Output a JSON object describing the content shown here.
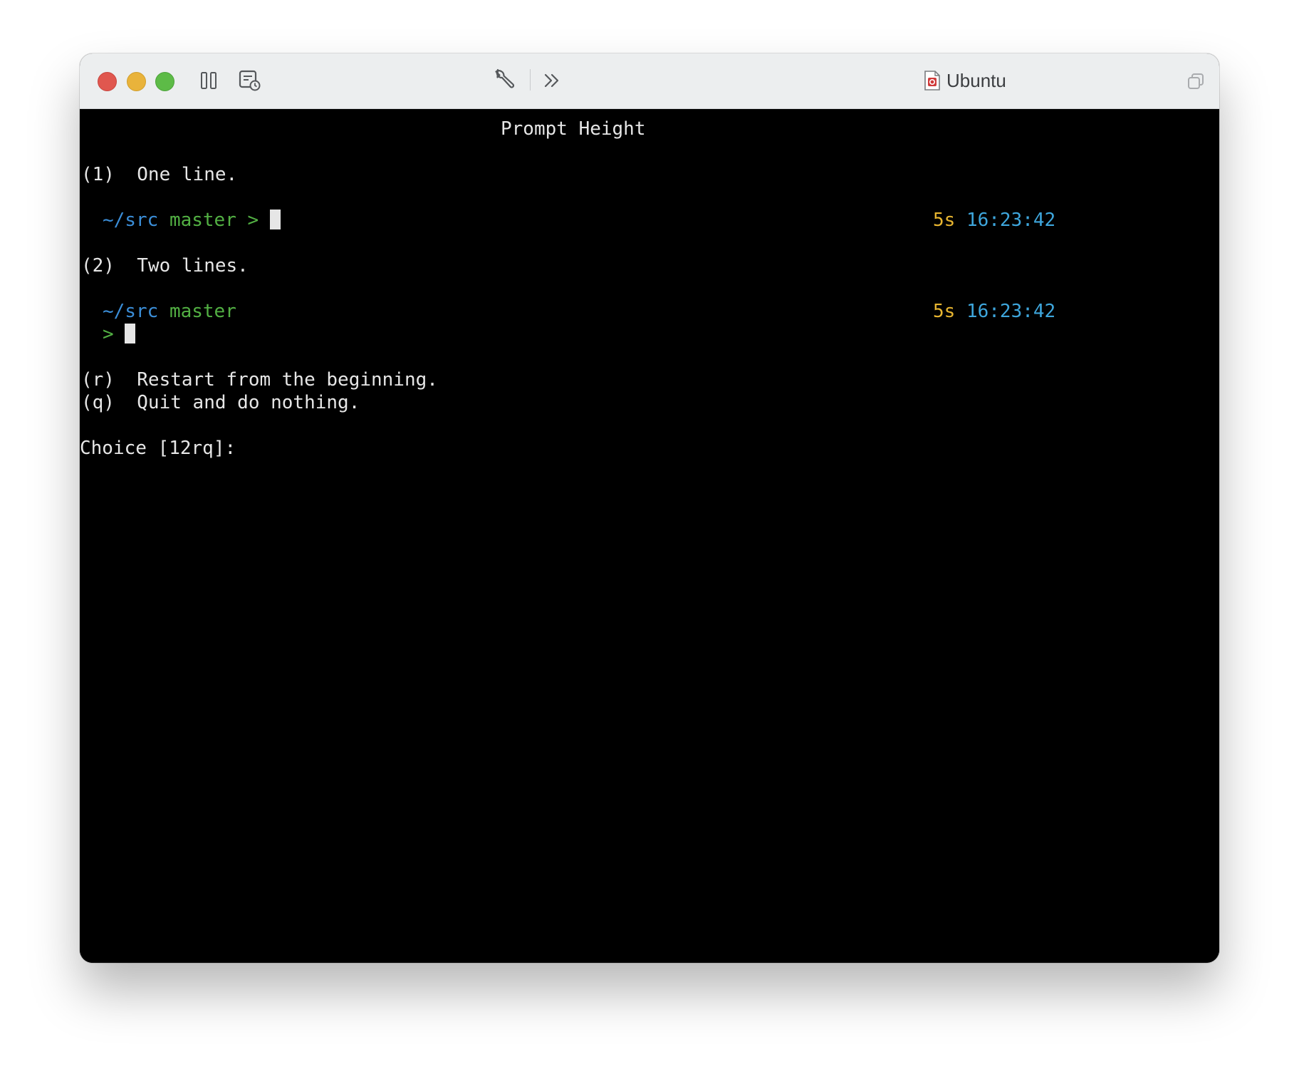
{
  "window": {
    "title": "Ubuntu"
  },
  "terminal": {
    "header": "Prompt Height",
    "option1": {
      "key": "(1)",
      "label": "One line."
    },
    "option1_prompt": {
      "dir": "~/src",
      "branch": "master",
      "symbol": ">",
      "duration": "5s",
      "time": "16:23:42"
    },
    "option2": {
      "key": "(2)",
      "label": "Two lines."
    },
    "option2_prompt": {
      "dir": "~/src",
      "branch": "master",
      "symbol": ">",
      "duration": "5s",
      "time": "16:23:42"
    },
    "option_r": {
      "key": "(r)",
      "label": "Restart from the beginning."
    },
    "option_q": {
      "key": "(q)",
      "label": "Quit and do nothing."
    },
    "choice_prompt": "Choice [12rq]:"
  },
  "colors": {
    "dir": "#3b8ed8",
    "branch": "#52b043",
    "duration": "#e8b530",
    "time": "#3ea6dc"
  },
  "icons": [
    "close-button",
    "minimize-button",
    "maximize-button",
    "pause-icon",
    "snapshot-icon",
    "wrench-icon",
    "chevron-double-right-icon",
    "vm-document-icon",
    "window-restore-icon"
  ]
}
